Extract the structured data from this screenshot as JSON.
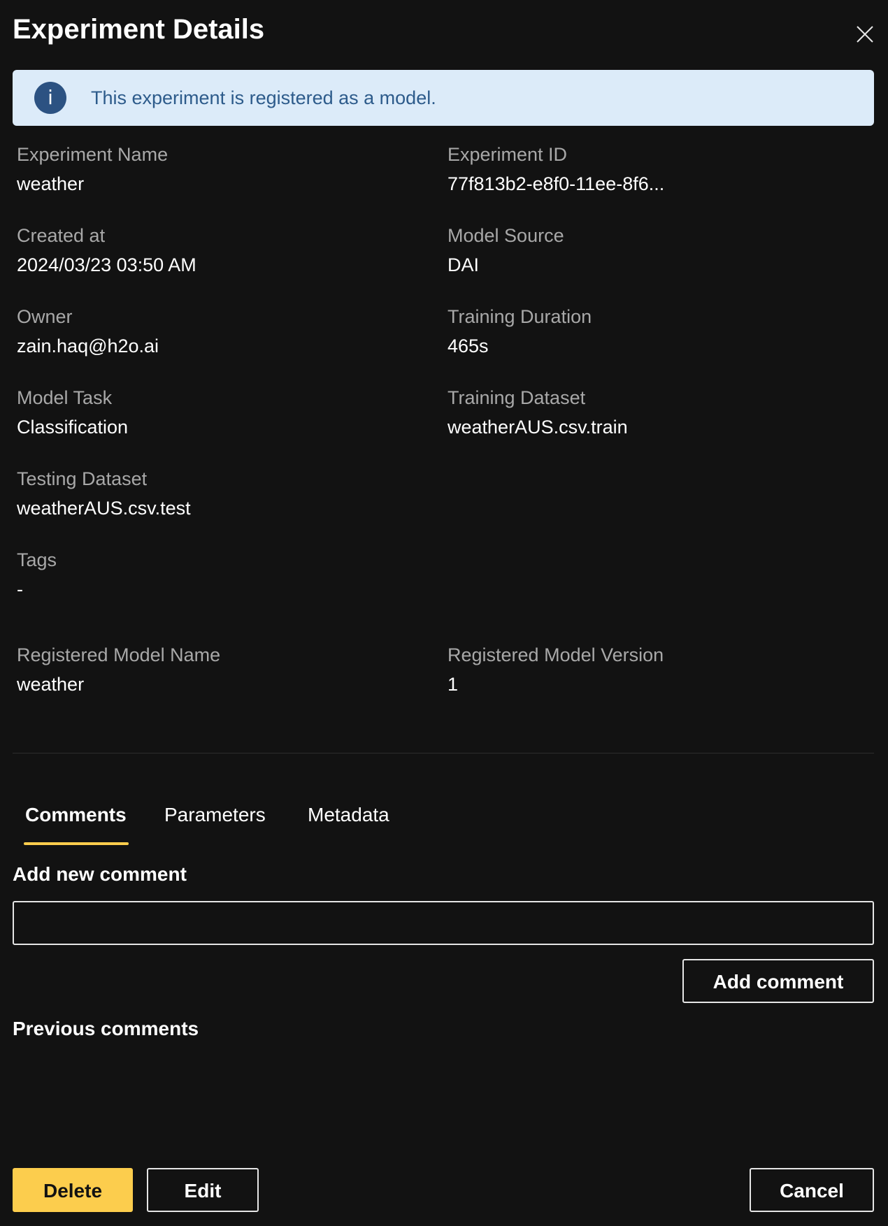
{
  "dialog": {
    "title": "Experiment Details",
    "close_icon": "close-icon"
  },
  "banner": {
    "icon": "info-icon",
    "icon_glyph": "i",
    "message": "This experiment is registered as a model."
  },
  "details": {
    "experiment_name": {
      "label": "Experiment Name",
      "value": "weather"
    },
    "experiment_id": {
      "label": "Experiment ID",
      "value": "77f813b2-e8f0-11ee-8f6..."
    },
    "created_at": {
      "label": "Created at",
      "value": "2024/03/23 03:50 AM"
    },
    "model_source": {
      "label": "Model Source",
      "value": "DAI"
    },
    "owner": {
      "label": "Owner",
      "value": "zain.haq@h2o.ai"
    },
    "training_duration": {
      "label": "Training Duration",
      "value": "465s"
    },
    "model_task": {
      "label": "Model Task",
      "value": "Classification"
    },
    "training_dataset": {
      "label": "Training Dataset",
      "value": "weatherAUS.csv.train"
    },
    "testing_dataset": {
      "label": "Testing Dataset",
      "value": "weatherAUS.csv.test"
    },
    "tags": {
      "label": "Tags",
      "value": "-"
    },
    "registered_model_name": {
      "label": "Registered Model Name",
      "value": "weather"
    },
    "registered_model_version": {
      "label": "Registered Model Version",
      "value": "1"
    }
  },
  "tabs": [
    {
      "label": "Comments",
      "active": true
    },
    {
      "label": "Parameters",
      "active": false
    },
    {
      "label": "Metadata",
      "active": false
    }
  ],
  "comments": {
    "add_heading": "Add new comment",
    "input_value": "",
    "input_placeholder": "",
    "add_button": "Add comment",
    "previous_heading": "Previous comments"
  },
  "footer": {
    "delete": "Delete",
    "edit": "Edit",
    "cancel": "Cancel"
  },
  "colors": {
    "background": "#121212",
    "accent": "#fccd4d",
    "banner_bg": "#dcebf9",
    "banner_text": "#2d5b8b",
    "info_icon_bg": "#2c5282"
  }
}
